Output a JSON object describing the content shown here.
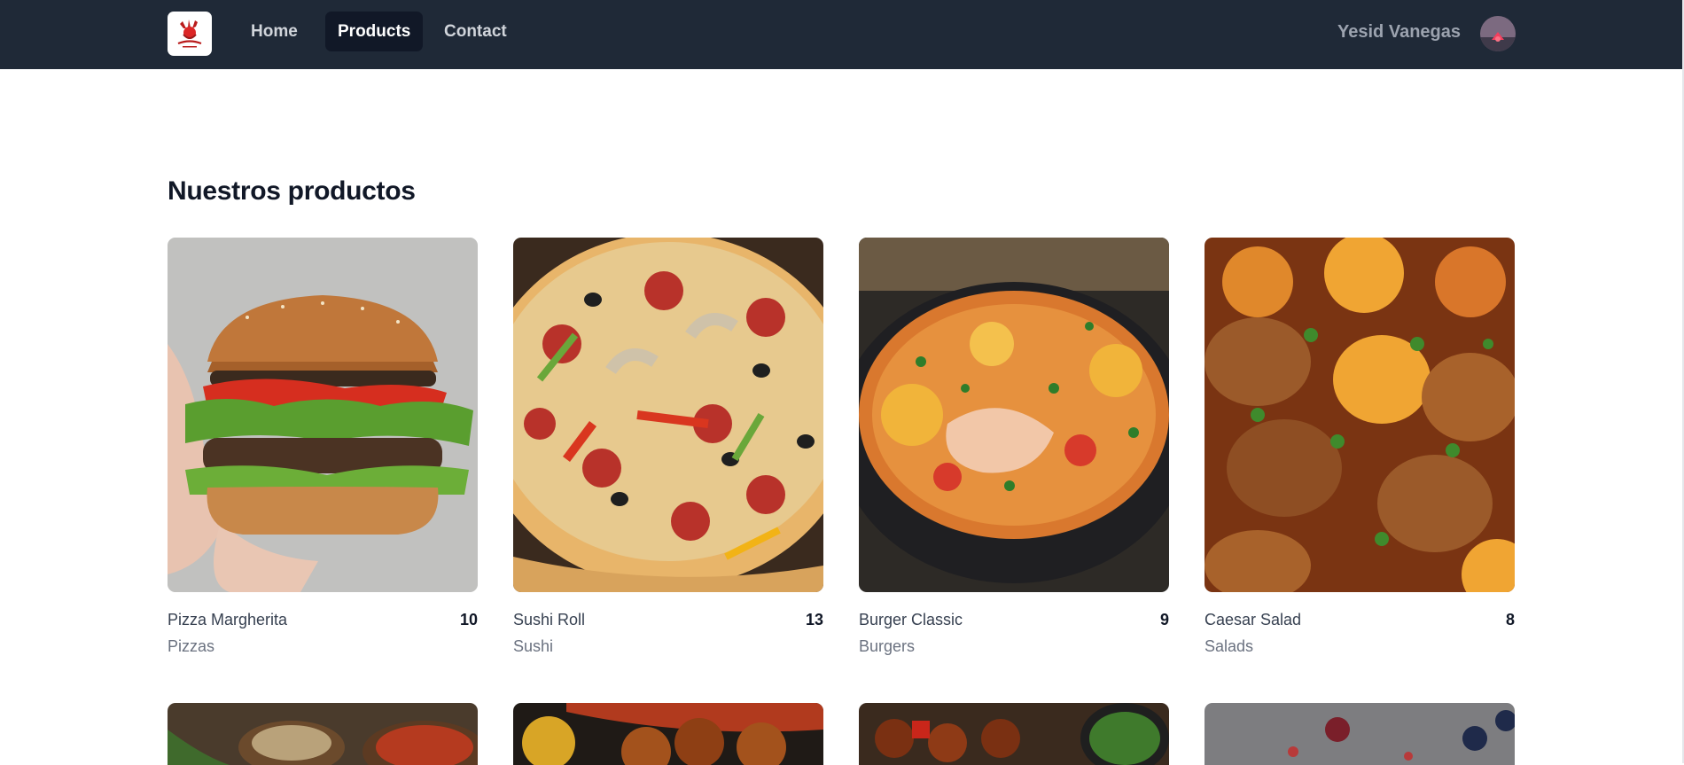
{
  "header": {
    "nav": [
      {
        "label": "Home",
        "active": false
      },
      {
        "label": "Products",
        "active": true
      },
      {
        "label": "Contact",
        "active": false
      }
    ],
    "user_name": "Yesid Vanegas",
    "logo_icon": "restaurant-logo-icon",
    "avatar_icon": "user-avatar"
  },
  "main": {
    "title": "Nuestros productos",
    "products": [
      {
        "name": "Pizza Margherita",
        "quantity": "10",
        "category": "Pizzas",
        "image": "burger-photo"
      },
      {
        "name": "Sushi Roll",
        "quantity": "13",
        "category": "Sushi",
        "image": "pizza-photo"
      },
      {
        "name": "Burger Classic",
        "quantity": "9",
        "category": "Burgers",
        "image": "stew-photo"
      },
      {
        "name": "Caesar Salad",
        "quantity": "8",
        "category": "Salads",
        "image": "chicken-curry-photo"
      }
    ],
    "next_row_images": [
      "spices-photo",
      "fried-chicken-photo",
      "kebab-photo",
      "berries-photo"
    ]
  },
  "colors": {
    "navbar": "#1f2937",
    "active_nav": "#111827",
    "nav_text": "#d1d5db",
    "title": "#111827",
    "category_text": "#6b7280"
  }
}
